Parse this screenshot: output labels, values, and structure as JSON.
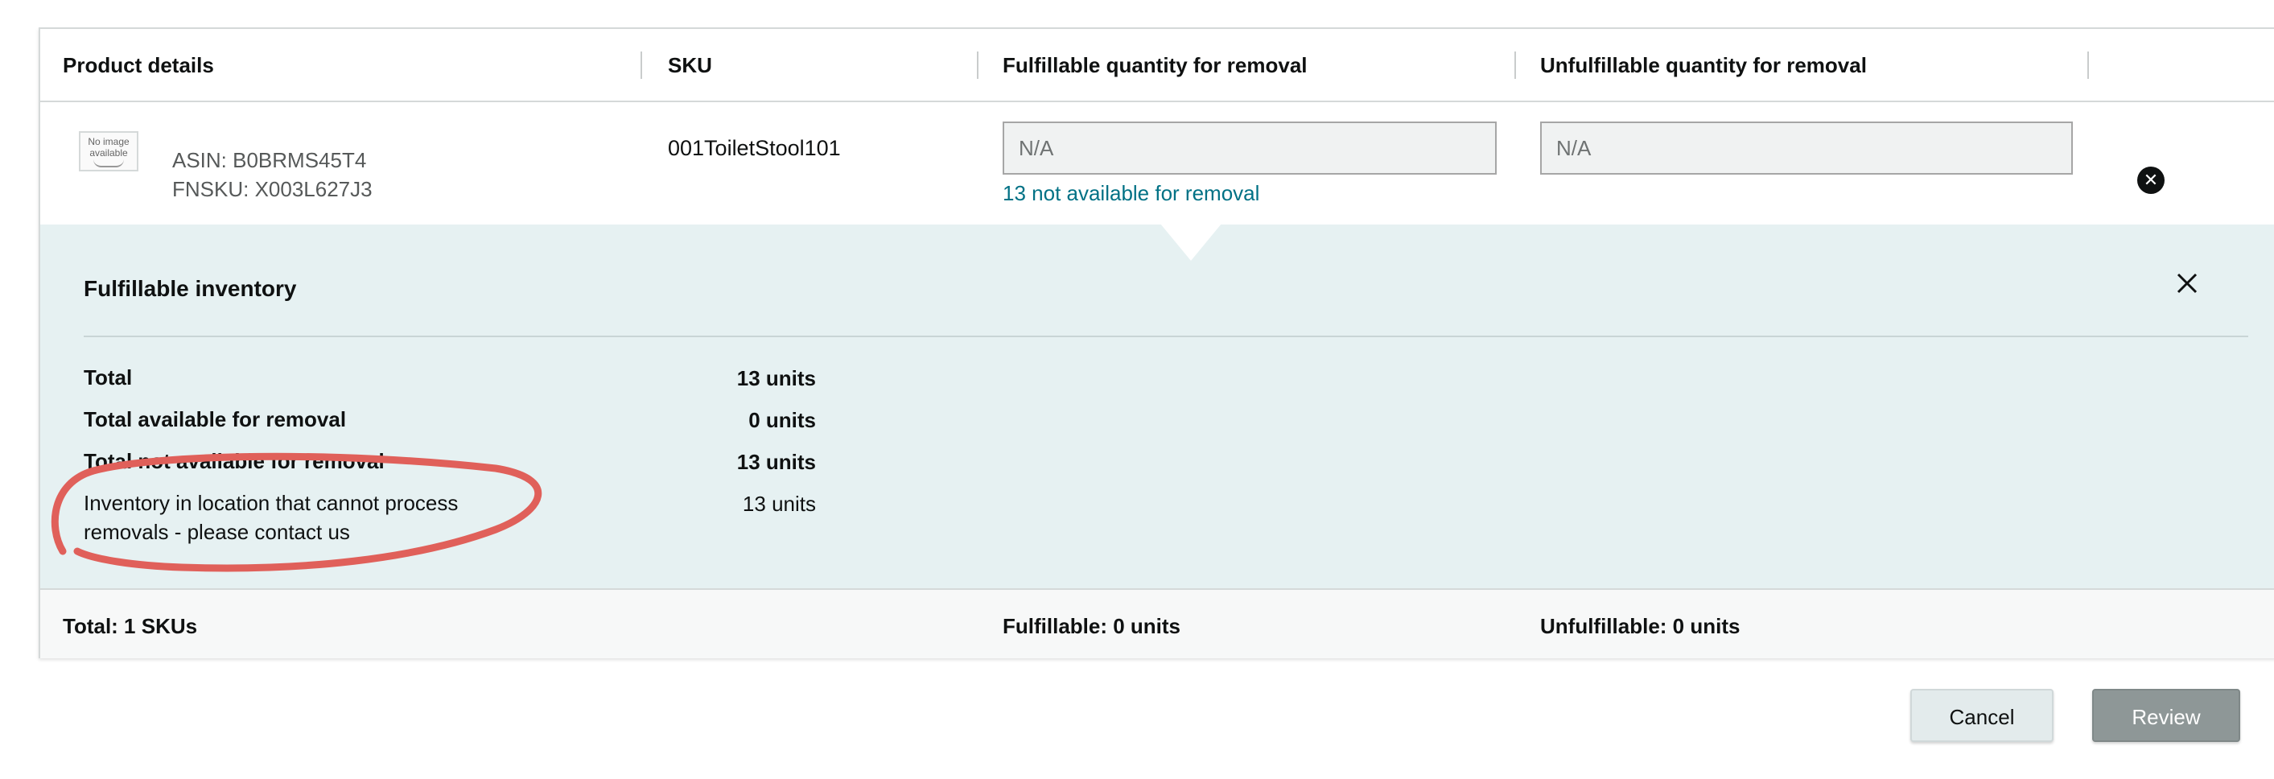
{
  "table": {
    "headers": {
      "product_details": "Product details",
      "sku": "SKU",
      "fulfillable": "Fulfillable quantity for removal",
      "unfulfillable": "Unfulfillable quantity for removal"
    },
    "row": {
      "thumbnail_text": "No image available",
      "asin": "ASIN: B0BRMS45T4",
      "fnsku": "FNSKU: X003L627J3",
      "sku": "001ToiletStool101",
      "fulfillable_placeholder": "N/A",
      "unfulfillable_placeholder": "N/A",
      "not_available_note": "13 not available for removal",
      "remove_icon": "x-circle-icon"
    }
  },
  "popover": {
    "title": "Fulfillable inventory",
    "close_icon": "close-icon",
    "stats": [
      {
        "label": "Total",
        "value": "13 units"
      },
      {
        "label": "Total available for removal",
        "value": "0 units"
      },
      {
        "label": "Total not available for removal",
        "value": "13 units"
      },
      {
        "label": "Inventory in location that cannot process removals - please contact us",
        "value": "13 units"
      }
    ]
  },
  "footer": {
    "total": "Total: 1 SKUs",
    "fulfillable": "Fulfillable: 0 units",
    "unfulfillable": "Unfulfillable: 0 units"
  },
  "actions": {
    "cancel": "Cancel",
    "review": "Review"
  },
  "colors": {
    "link": "#007185",
    "popover_bg": "#e6f1f2",
    "annotation": "#e0605a",
    "review_disabled": "#8e9797"
  }
}
